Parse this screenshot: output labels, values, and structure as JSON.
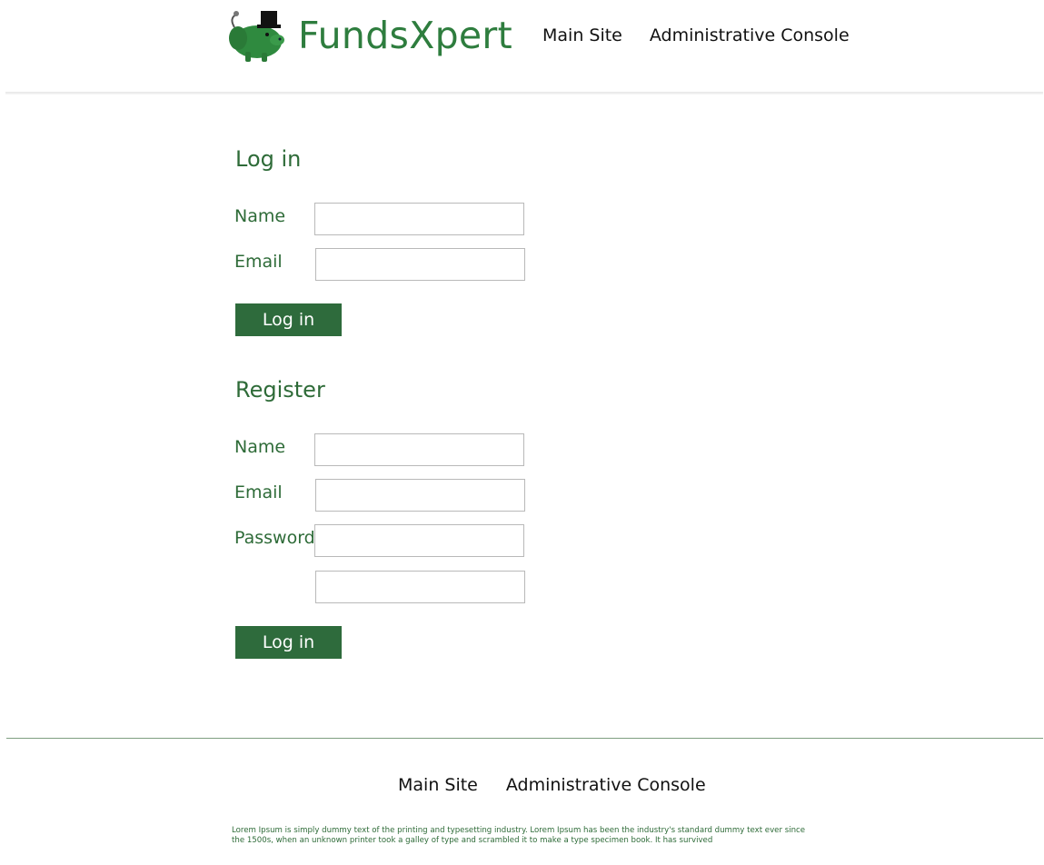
{
  "header": {
    "logo_icon": "pig-with-top-hat-icon",
    "brand": "FundsXpert",
    "nav": [
      {
        "label": "Main Site"
      },
      {
        "label": "Administrative Console"
      }
    ]
  },
  "login": {
    "title": "Log in",
    "name_label": "Name",
    "email_label": "Email",
    "name_value": "",
    "email_value": "",
    "submit_label": "Log in"
  },
  "register": {
    "title": "Register",
    "name_label": "Name",
    "email_label": "Email",
    "password_label": "Password",
    "name_value": "",
    "email_value": "",
    "password_value": "",
    "confirm_value": "",
    "submit_label": "Log in"
  },
  "footer": {
    "nav": [
      {
        "label": "Main Site"
      },
      {
        "label": "Administrative Console"
      }
    ],
    "text": "Lorem Ipsum is simply dummy text of the printing and typesetting industry. Lorem Ipsum has been the industry's standard dummy text ever since the 1500s, when an unknown printer took a galley of type and scrambled it to make a type specimen book. It has survived"
  },
  "colors": {
    "brand_green": "#2e7d3e",
    "button_green": "#2e6b3c"
  }
}
